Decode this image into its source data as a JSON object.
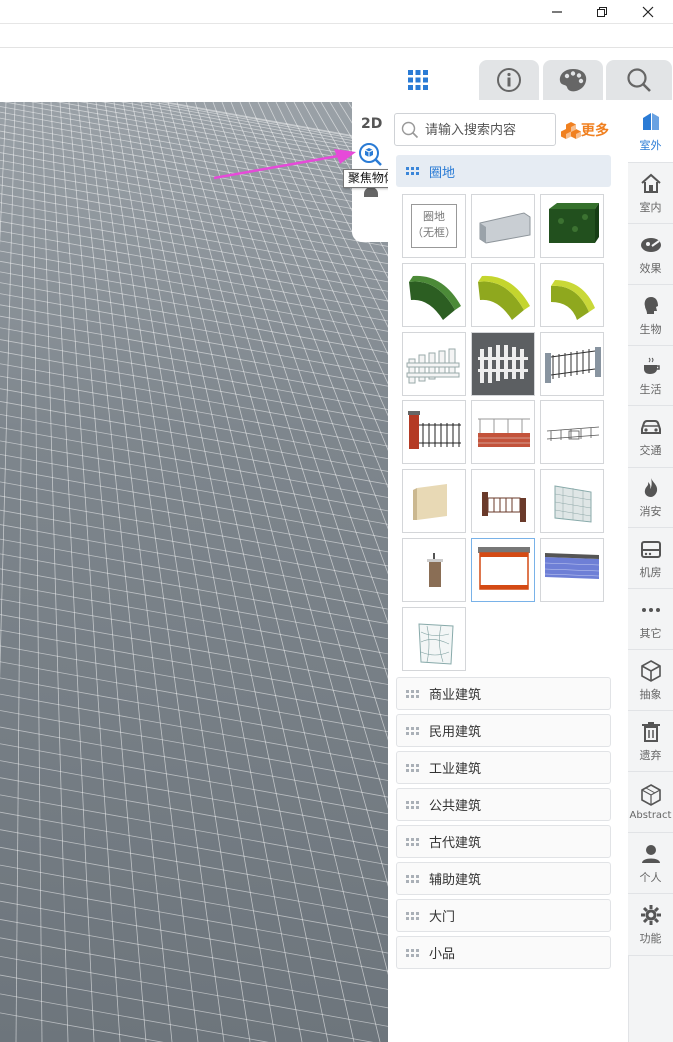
{
  "viewport": {
    "mode_label": "2D",
    "tooltip": "聚焦物体(F)"
  },
  "tabs": [
    {
      "icon": "grid-icon",
      "active": true
    },
    {
      "icon": "info-icon",
      "active": false
    },
    {
      "icon": "palette-icon",
      "active": false
    },
    {
      "icon": "search-icon",
      "active": false
    }
  ],
  "search": {
    "placeholder": "请输入搜索内容",
    "more_label": "更多"
  },
  "current_category": {
    "label": "圈地"
  },
  "tiles": [
    {
      "name": "tile-enclosure-frameless",
      "label_top": "圈地",
      "label_bottom": "（无框）"
    },
    {
      "name": "tile-concrete-block"
    },
    {
      "name": "tile-hedge-box"
    },
    {
      "name": "tile-hedge-curve-dark"
    },
    {
      "name": "tile-hedge-curve-yellow"
    },
    {
      "name": "tile-hedge-quarter-yellow"
    },
    {
      "name": "tile-picket-fence-white"
    },
    {
      "name": "tile-picket-fence-dark-bg"
    },
    {
      "name": "tile-iron-fence"
    },
    {
      "name": "tile-brick-pillar-fence"
    },
    {
      "name": "tile-brick-wall-rail"
    },
    {
      "name": "tile-thin-rail"
    },
    {
      "name": "tile-beige-panel"
    },
    {
      "name": "tile-wooden-fence"
    },
    {
      "name": "tile-chain-mesh"
    },
    {
      "name": "tile-post-sign"
    },
    {
      "name": "tile-orange-wall-selected"
    },
    {
      "name": "tile-blue-brick-wall"
    },
    {
      "name": "tile-wire-mesh-panel"
    }
  ],
  "categories": [
    "商业建筑",
    "民用建筑",
    "工业建筑",
    "公共建筑",
    "古代建筑",
    "辅助建筑",
    "大门",
    "小品"
  ],
  "category_strip": [
    {
      "label": "室外",
      "icon": "building-icon",
      "active": true
    },
    {
      "label": "室内",
      "icon": "house-icon"
    },
    {
      "label": "效果",
      "icon": "effects-icon"
    },
    {
      "label": "生物",
      "icon": "head-icon"
    },
    {
      "label": "生活",
      "icon": "cup-icon"
    },
    {
      "label": "交通",
      "icon": "car-icon"
    },
    {
      "label": "消安",
      "icon": "fire-icon"
    },
    {
      "label": "机房",
      "icon": "server-icon"
    },
    {
      "label": "其它",
      "icon": "more-dots-icon"
    },
    {
      "label": "抽象",
      "icon": "cube-icon"
    },
    {
      "label": "遗弃",
      "icon": "trash-icon"
    },
    {
      "label": "Abstract",
      "icon": "wire-cube-icon"
    },
    {
      "label": "个人",
      "icon": "user-icon"
    },
    {
      "label": "功能",
      "icon": "gear-icon"
    }
  ],
  "colors": {
    "accent": "#2a7bd5",
    "more": "#f08020",
    "arrow": "#e64ad9"
  }
}
